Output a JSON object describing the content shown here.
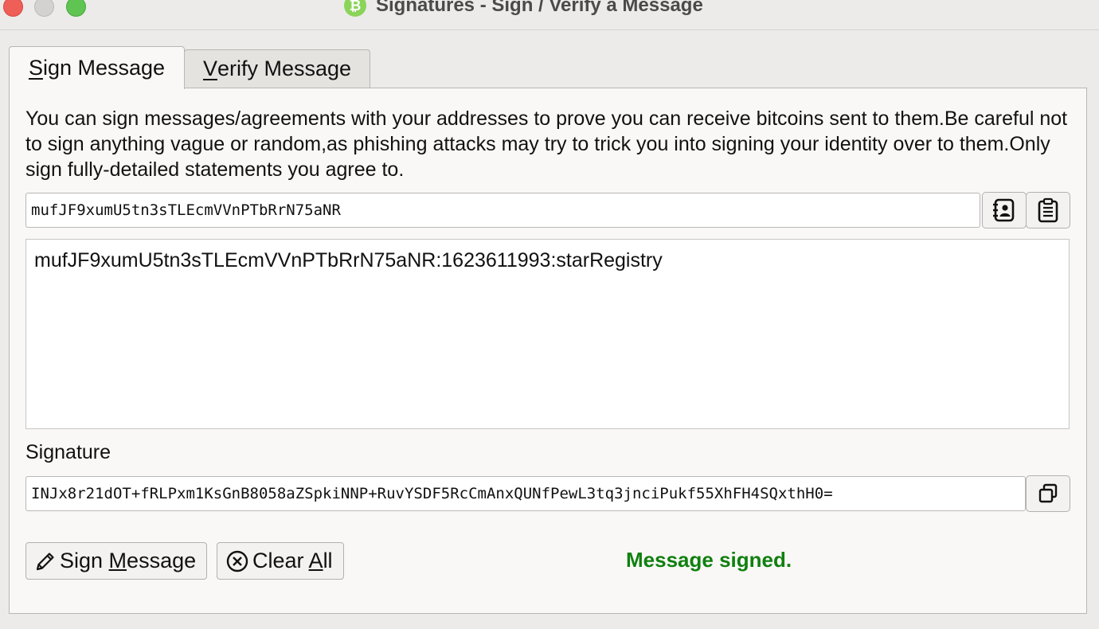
{
  "window": {
    "title": "Signatures - Sign / Verify a Message",
    "app_icon_glyph": "₿"
  },
  "tabs": [
    {
      "label_first": "S",
      "label_rest": "ign Message",
      "active": true
    },
    {
      "label_first": "V",
      "label_rest": "erify Message",
      "active": false
    }
  ],
  "sign": {
    "description": "You can sign messages/agreements with your addresses to prove you can receive bitcoins sent to them.Be careful not to sign anything vague or random,as phishing attacks may try to trick you into signing your identity over to them.Only sign fully-detailed statements you agree to.",
    "address_value": "mufJF9xumU5tn3sTLEcmVVnPTbRrN75aNR",
    "message_value": "mufJF9xumU5tn3sTLEcmVVnPTbRrN75aNR:1623611993:starRegistry",
    "signature_label": "Signature",
    "signature_value": "INJx8r21dOT+fRLPxm1KsGnB8058aZSpkiNNP+RuvYSDF5RcCmAnxQUNfPewL3tq3jnciPukf55XhFH4SQxthH0=",
    "sign_button": {
      "pre": "Sign ",
      "mnemonic": "M",
      "post": "essage"
    },
    "clear_button": {
      "pre": "Clear ",
      "mnemonic": "A",
      "post": "ll"
    },
    "status": "Message signed."
  },
  "icons": {
    "address_book": "address-book-icon",
    "paste": "paste-icon",
    "copy": "copy-icon",
    "pencil": "pencil-icon",
    "clear": "clear-circle-x-icon"
  },
  "colors": {
    "status_green": "#108010",
    "app_icon": "#8bd45a"
  }
}
